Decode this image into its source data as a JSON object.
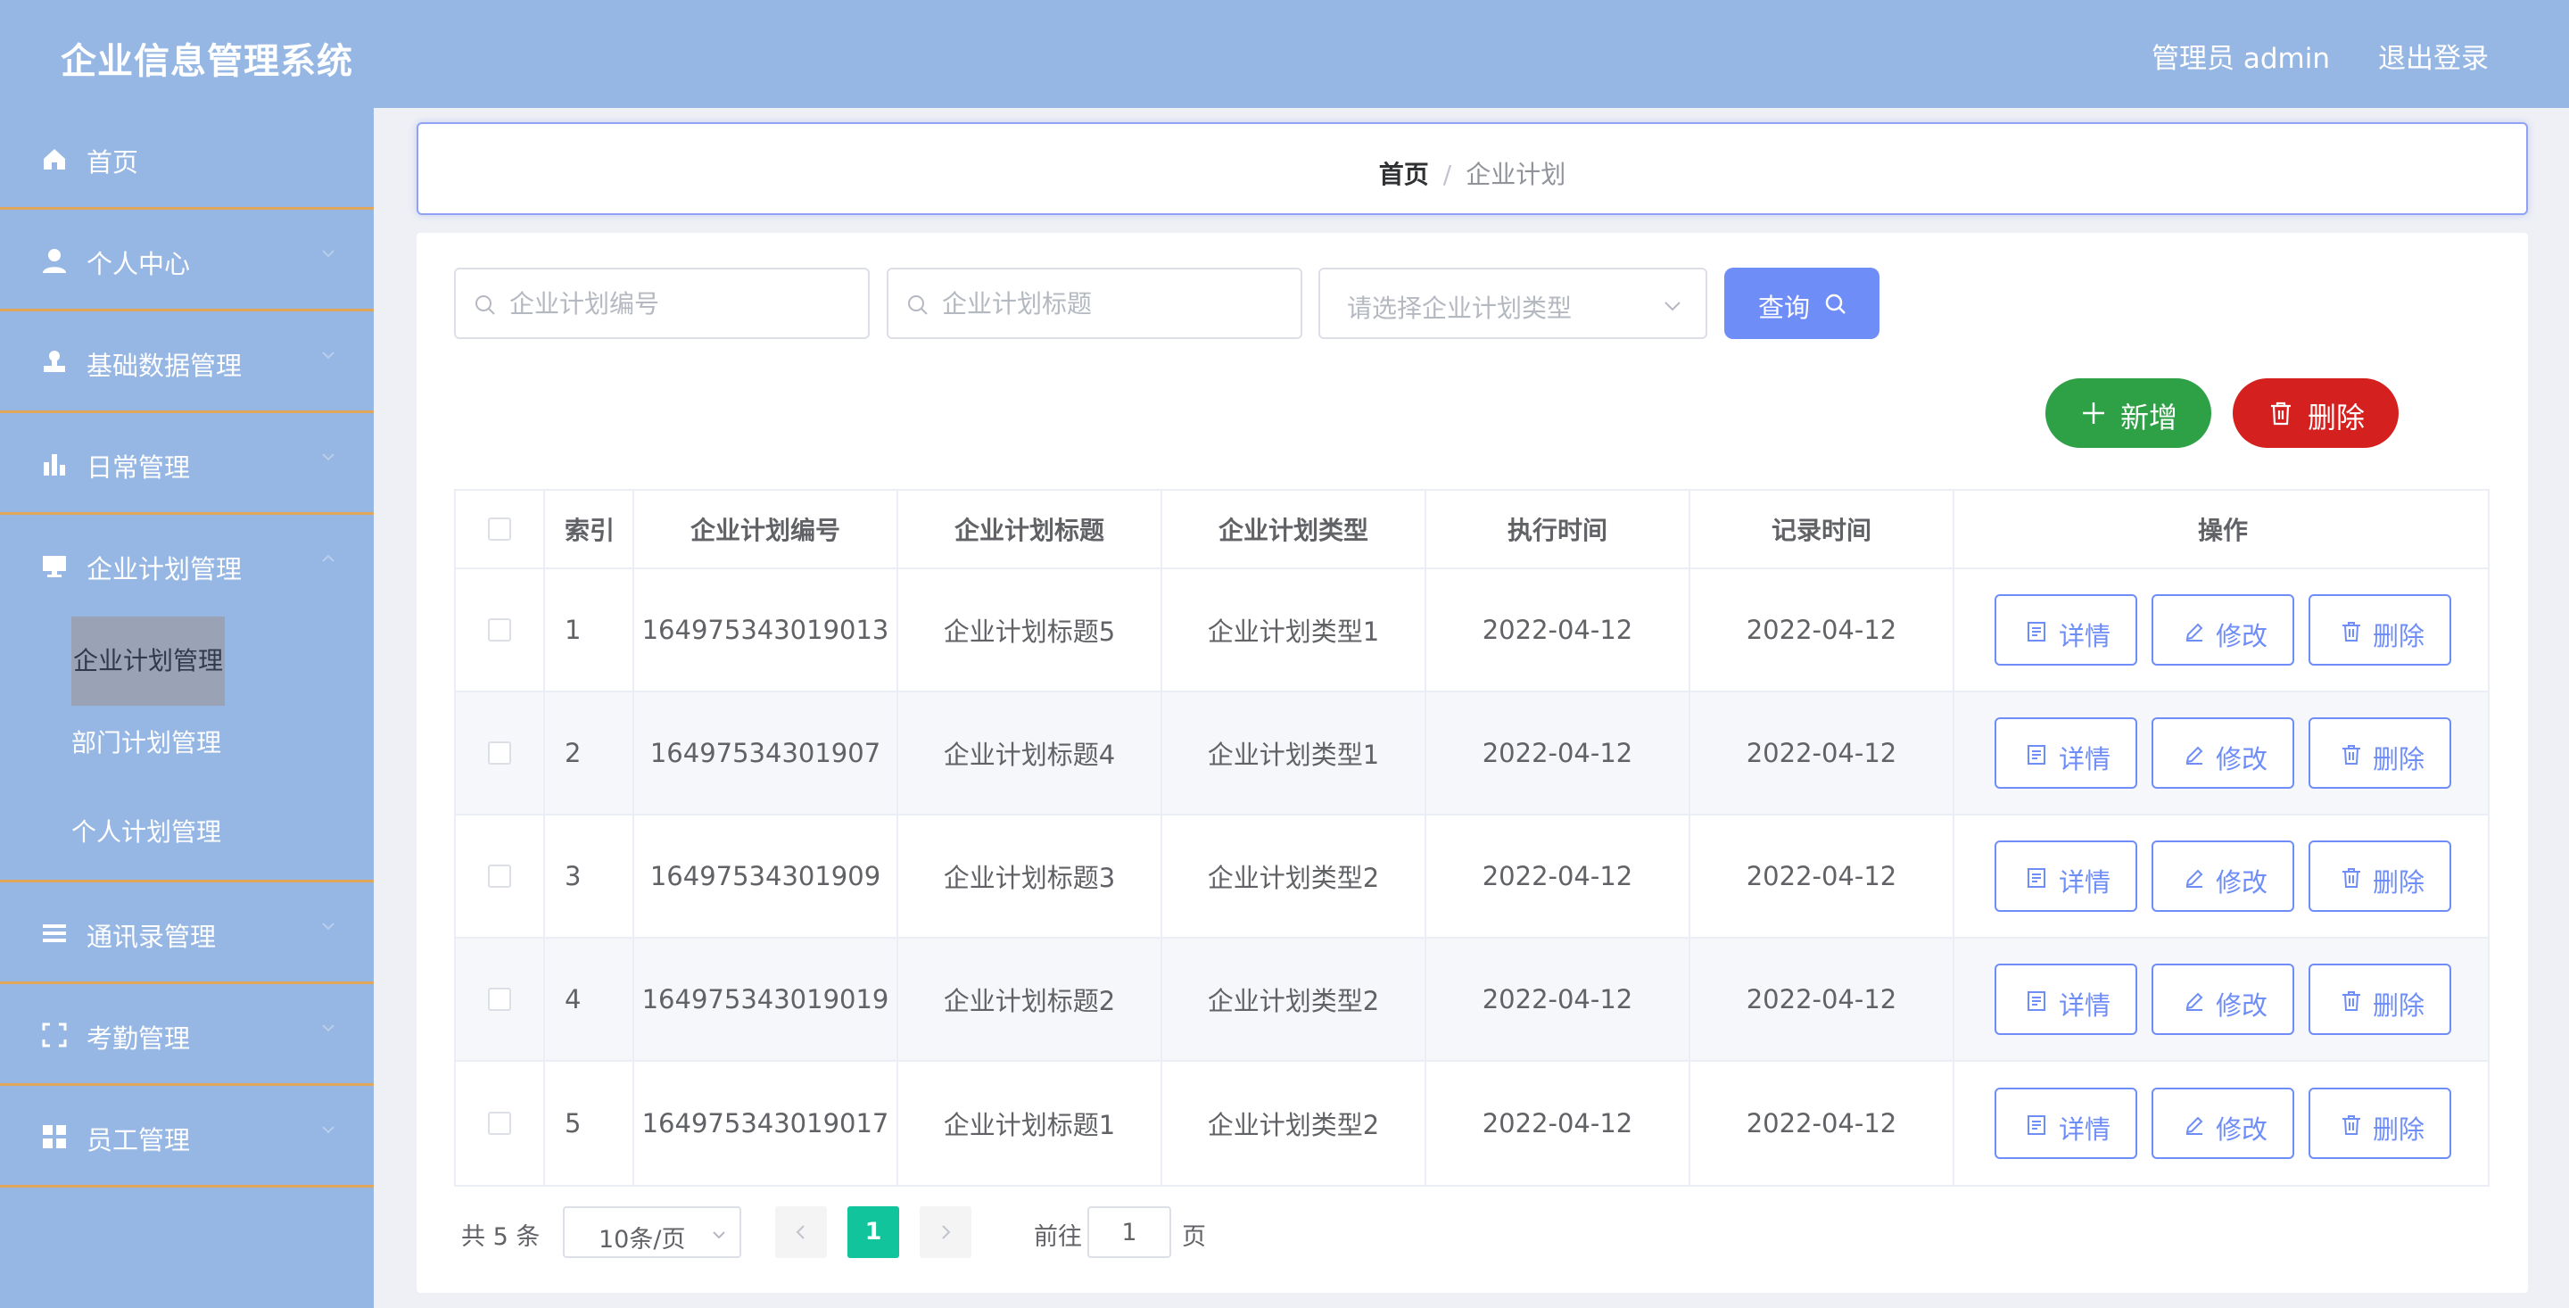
{
  "header": {
    "app_title": "企业信息管理系统",
    "user_label": "管理员 admin",
    "logout_label": "退出登录"
  },
  "sidebar": {
    "items": [
      {
        "label": "首页",
        "icon": "home-icon"
      },
      {
        "label": "个人中心",
        "icon": "user-icon"
      },
      {
        "label": "基础数据管理",
        "icon": "stamp-icon"
      },
      {
        "label": "日常管理",
        "icon": "bar-chart-icon"
      },
      {
        "label": "企业计划管理",
        "icon": "monitor-icon"
      },
      {
        "label": "通讯录管理",
        "icon": "list-icon"
      },
      {
        "label": "考勤管理",
        "icon": "frame-icon"
      },
      {
        "label": "员工管理",
        "icon": "grid-icon"
      }
    ],
    "submenu": [
      {
        "label": "企业计划管理",
        "active": true
      },
      {
        "label": "部门计划管理",
        "active": false
      },
      {
        "label": "个人计划管理",
        "active": false
      }
    ]
  },
  "breadcrumb": {
    "home": "首页",
    "separator": "/",
    "current": "企业计划"
  },
  "search": {
    "code_placeholder": "企业计划编号",
    "title_placeholder": "企业计划标题",
    "type_placeholder": "请选择企业计划类型",
    "query_label": "查询"
  },
  "actions": {
    "add_label": "新增",
    "delete_label": "删除"
  },
  "table": {
    "columns": [
      "索引",
      "企业计划编号",
      "企业计划标题",
      "企业计划类型",
      "执行时间",
      "记录时间",
      "操作"
    ],
    "rows": [
      {
        "index": "1",
        "code": "164975343019013",
        "title": "企业计划标题5",
        "type": "企业计划类型1",
        "exec_time": "2022-04-12",
        "record_time": "2022-04-12"
      },
      {
        "index": "2",
        "code": "16497534301907",
        "title": "企业计划标题4",
        "type": "企业计划类型1",
        "exec_time": "2022-04-12",
        "record_time": "2022-04-12"
      },
      {
        "index": "3",
        "code": "16497534301909",
        "title": "企业计划标题3",
        "type": "企业计划类型2",
        "exec_time": "2022-04-12",
        "record_time": "2022-04-12"
      },
      {
        "index": "4",
        "code": "164975343019019",
        "title": "企业计划标题2",
        "type": "企业计划类型2",
        "exec_time": "2022-04-12",
        "record_time": "2022-04-12"
      },
      {
        "index": "5",
        "code": "164975343019017",
        "title": "企业计划标题1",
        "type": "企业计划类型2",
        "exec_time": "2022-04-12",
        "record_time": "2022-04-12"
      }
    ],
    "row_actions": {
      "detail": "详情",
      "edit": "修改",
      "delete": "删除"
    }
  },
  "pagination": {
    "total": "共 5 条",
    "page_size": "10条/页",
    "current_page": "1",
    "goto_label": "前往",
    "goto_value": "1",
    "page_unit": "页"
  },
  "colors": {
    "header_bg": "#96b7e4",
    "primary": "#6f8df7",
    "success": "#2ea146",
    "danger": "#d4211f",
    "page_active": "#12c49b",
    "menu_divider": "#e2a65a"
  }
}
